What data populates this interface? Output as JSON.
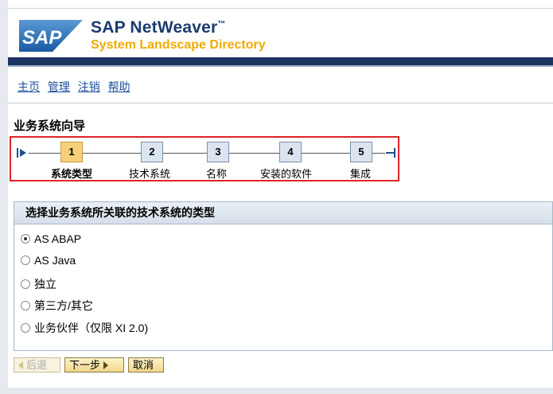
{
  "header": {
    "logo_text": "SAP",
    "product": "SAP NetWeaver",
    "product_mark": "™",
    "subtitle": "System Landscape Directory"
  },
  "menu": [
    "主页",
    "管理",
    "注销",
    "帮助"
  ],
  "wizard": {
    "title": "业务系统向导",
    "steps": [
      {
        "num": "1",
        "label": "系统类型",
        "active": true
      },
      {
        "num": "2",
        "label": "技术系统",
        "active": false
      },
      {
        "num": "3",
        "label": "名称",
        "active": false
      },
      {
        "num": "4",
        "label": "安装的软件",
        "active": false
      },
      {
        "num": "5",
        "label": "集成",
        "active": false
      }
    ]
  },
  "panel": {
    "heading": "选择业务系统所关联的技术系统的类型",
    "options": [
      {
        "label": "AS ABAP",
        "checked": true
      },
      {
        "label": "AS Java",
        "checked": false
      },
      {
        "label": "独立",
        "checked": false
      },
      {
        "label": "第三方/其它",
        "checked": false
      },
      {
        "label": "业务伙伴（仅限 XI 2.0)",
        "checked": false
      }
    ]
  },
  "buttons": {
    "back": "后退",
    "next": "下一步",
    "cancel": "取消"
  },
  "colors": {
    "brand_blue": "#1b3b6f",
    "brand_gold": "#f0ab00",
    "highlight_red": "#e0242a",
    "active_step": "#f7d17a"
  }
}
